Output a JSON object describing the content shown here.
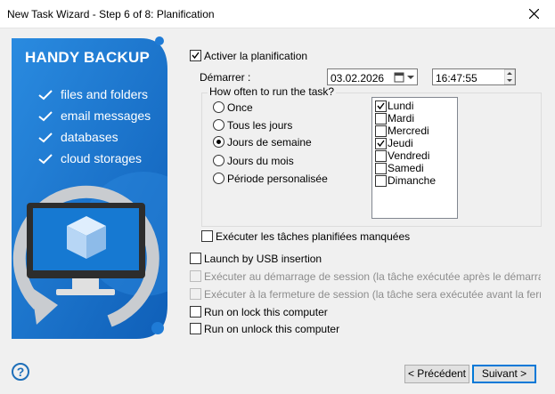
{
  "window": {
    "title": "New Task Wizard - Step 6 of 8: Planification"
  },
  "banner": {
    "brand": "HANDY BACKUP",
    "features": [
      "files and folders",
      "email messages",
      "databases",
      "cloud storages"
    ],
    "colors": {
      "primary": "#1f7bd6",
      "light": "#5fb0f2"
    }
  },
  "schedule": {
    "enable_label": "Activer la planification",
    "enable_checked": true,
    "start_label": "Démarrer :",
    "start_date": "03.02.2026",
    "start_time": "16:47:55",
    "frequency_label": "How often to run the task?",
    "frequency_options": [
      "Once",
      "Tous les jours",
      "Jours de semaine",
      "Jours du mois",
      "Période personalisée"
    ],
    "frequency_selected": "Jours de semaine",
    "days": [
      {
        "label": "Lundi",
        "checked": true
      },
      {
        "label": "Mardi",
        "checked": false
      },
      {
        "label": "Mercredi",
        "checked": false
      },
      {
        "label": "Jeudi",
        "checked": true
      },
      {
        "label": "Vendredi",
        "checked": false
      },
      {
        "label": "Samedi",
        "checked": false
      },
      {
        "label": "Dimanche",
        "checked": false
      }
    ],
    "missed_label": "Exécuter les tâches planifiées manquées"
  },
  "triggers": {
    "usb_label": "Launch by USB insertion",
    "login_label": "Exécuter au démarrage de session (la tâche exécutée après le démarrage de v",
    "logout_label": "Exécuter à la fermeture de session (la tâche sera exécutée avant la fermeture d",
    "lock_label": "Run on lock this computer",
    "unlock_label": "Run on unlock this computer"
  },
  "footer": {
    "help_symbol": "?",
    "back_label": "< Précédent",
    "next_label": "Suivant >"
  }
}
